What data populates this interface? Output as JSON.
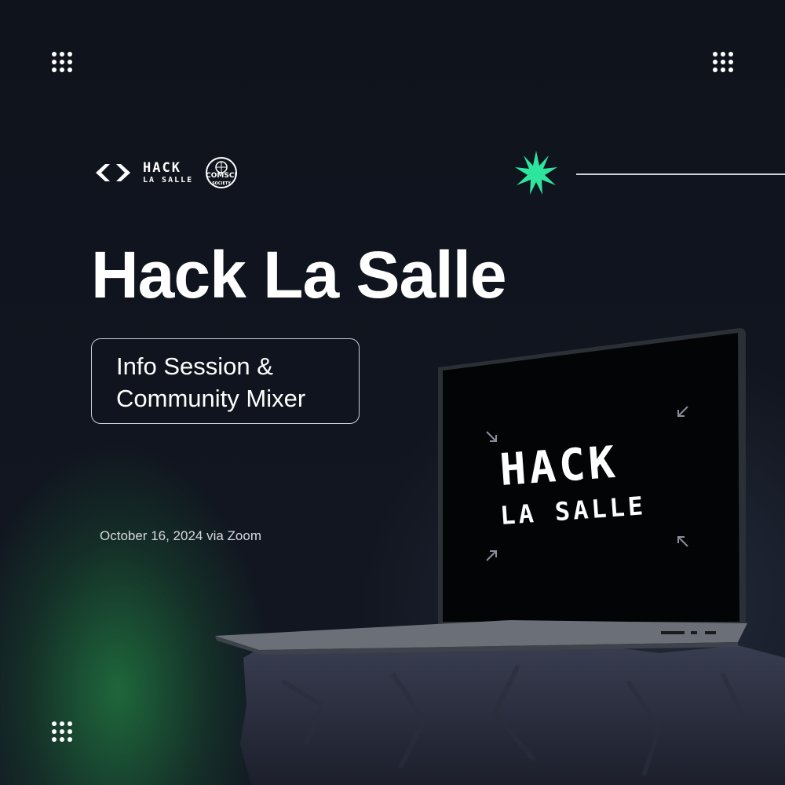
{
  "logo": {
    "line1": "HACK",
    "line2": "LA SALLE",
    "badge_top": "COMSCI",
    "badge_bottom": "SOCIETY"
  },
  "title": "Hack La Salle",
  "pill": {
    "line1": "Info Session &",
    "line2": "Community Mixer"
  },
  "date": "October 16, 2024 via Zoom",
  "screen": {
    "line1": "HACK",
    "line2": "LA SALLE"
  },
  "colors": {
    "background": "#10141d",
    "accent_green": "#2ee59d",
    "glow_green": "#28aa50",
    "text": "#ffffff"
  },
  "icons": {
    "corner": "dot-grid-icon",
    "star": "sparkle-star-icon",
    "logo": "code-chevrons-icon"
  }
}
